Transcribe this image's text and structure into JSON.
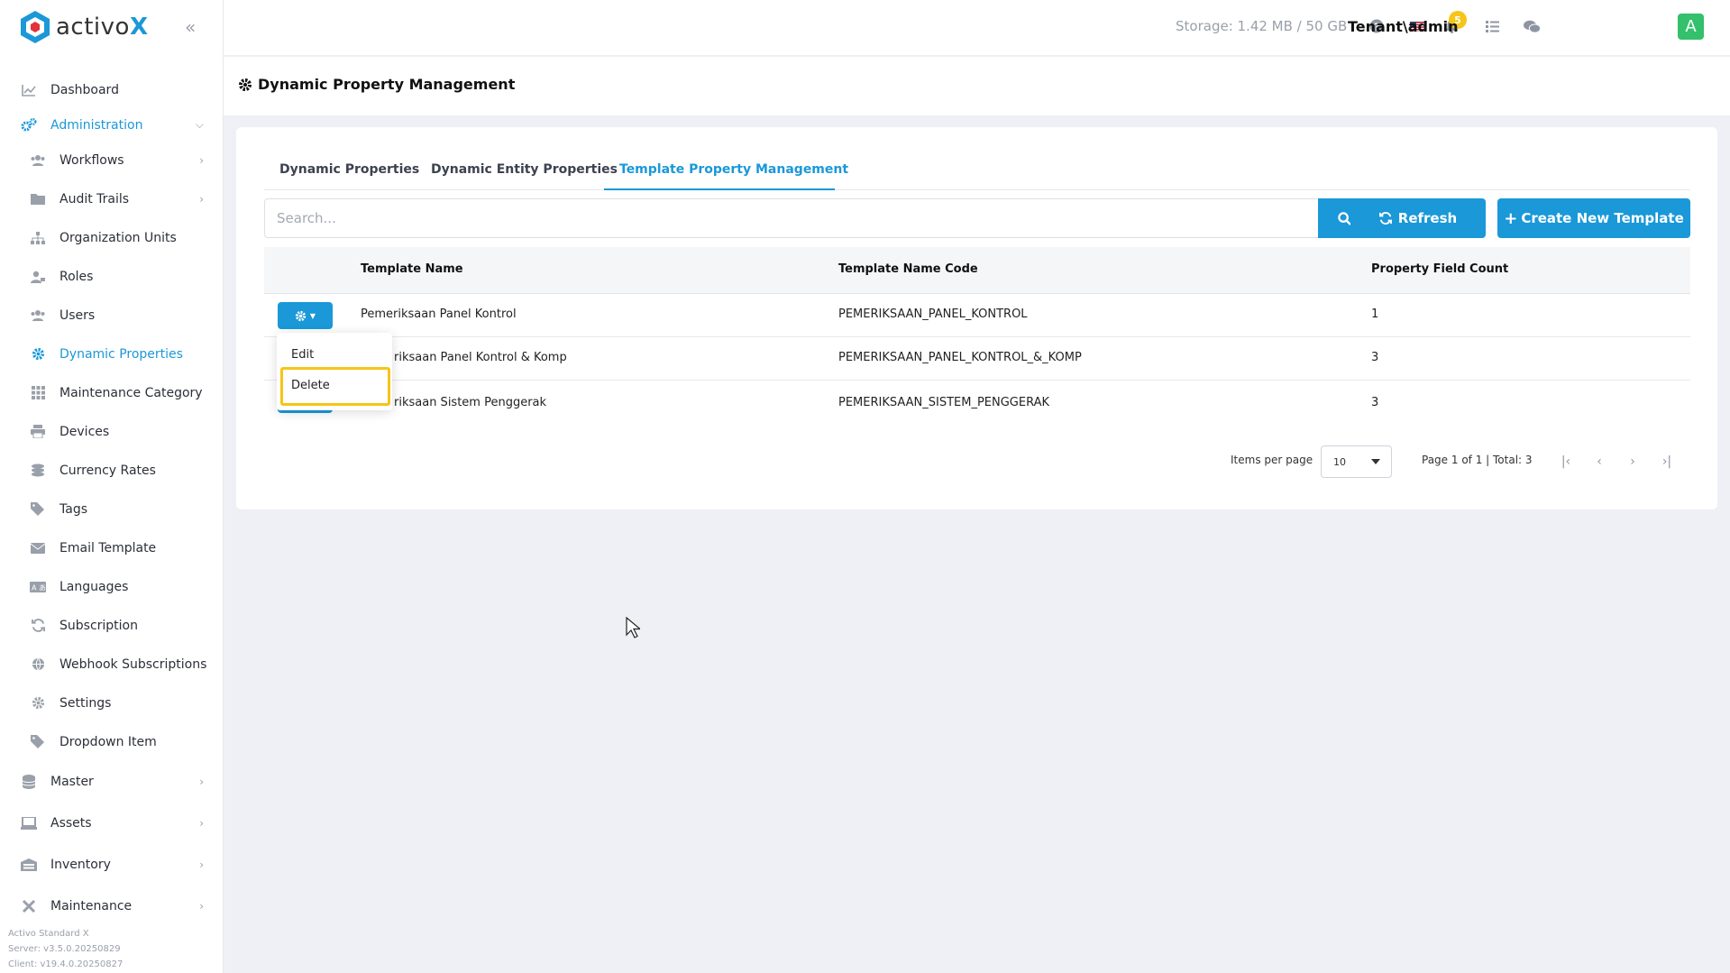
{
  "brand": {
    "name_pre": "activo",
    "name_post": "X"
  },
  "sidebar": {
    "items": [
      {
        "label": "Dashboard",
        "icon": "chart-line-icon"
      },
      {
        "label": "Administration",
        "icon": "cogs-icon",
        "active": true,
        "expanded": true
      },
      {
        "label": "Workflows",
        "icon": "users-icon",
        "has_children": true
      },
      {
        "label": "Audit Trails",
        "icon": "folder-icon",
        "has_children": true
      },
      {
        "label": "Organization Units",
        "icon": "sitemap-icon"
      },
      {
        "label": "Roles",
        "icon": "user-tag-icon"
      },
      {
        "label": "Users",
        "icon": "users-icon"
      },
      {
        "label": "Dynamic Properties",
        "icon": "gear-icon",
        "active": true
      },
      {
        "label": "Maintenance Category",
        "icon": "grid-icon"
      },
      {
        "label": "Devices",
        "icon": "printer-icon"
      },
      {
        "label": "Currency Rates",
        "icon": "coins-icon"
      },
      {
        "label": "Tags",
        "icon": "tags-icon"
      },
      {
        "label": "Email Template",
        "icon": "envelope-icon"
      },
      {
        "label": "Languages",
        "icon": "language-icon"
      },
      {
        "label": "Subscription",
        "icon": "refresh-icon"
      },
      {
        "label": "Webhook Subscriptions",
        "icon": "globe-icon"
      },
      {
        "label": "Settings",
        "icon": "gear-icon"
      },
      {
        "label": "Dropdown Item",
        "icon": "tags-icon"
      },
      {
        "label": "Master",
        "icon": "database-icon",
        "has_children": true
      },
      {
        "label": "Assets",
        "icon": "laptop-icon",
        "has_children": true
      },
      {
        "label": "Inventory",
        "icon": "warehouse-icon",
        "has_children": true
      },
      {
        "label": "Maintenance",
        "icon": "tools-icon",
        "has_children": true
      }
    ],
    "version": {
      "product": "Activo Standard X",
      "server": "Server: v3.5.0.20250829",
      "client": "Client: v19.4.0.20250827"
    }
  },
  "topbar": {
    "storage": "Storage: 1.42 MB / 50 GB",
    "notification_count": "5",
    "user": "Tenant\\admin",
    "avatar_letter": "A"
  },
  "page": {
    "title": "Dynamic Property Management"
  },
  "tabs": [
    {
      "label": "Dynamic Properties"
    },
    {
      "label": "Dynamic Entity Properties"
    },
    {
      "label": "Template Property Management",
      "active": true
    }
  ],
  "search": {
    "placeholder": "Search...",
    "value": ""
  },
  "buttons": {
    "refresh": "Refresh",
    "create": "Create New Template"
  },
  "table": {
    "columns": [
      "Template Name",
      "Template Name Code",
      "Property Field Count"
    ],
    "rows": [
      {
        "name": "Pemeriksaan Panel Kontrol",
        "code": "PEMERIKSAAN_PANEL_KONTROL",
        "count": "1"
      },
      {
        "name": "riksaan Panel Kontrol & Komp",
        "code": "PEMERIKSAAN_PANEL_KONTROL_&_KOMP",
        "count": "3"
      },
      {
        "name": "riksaan Sistem Penggerak",
        "code": "PEMERIKSAAN_SISTEM_PENGGERAK",
        "count": "3"
      }
    ]
  },
  "dropdown_menu": {
    "edit": "Edit",
    "delete": "Delete"
  },
  "pagination": {
    "items_per_page_label": "Items per page",
    "items_per_page": "10",
    "page_info": "Page 1 of 1 | Total: 3"
  },
  "colors": {
    "accent": "#1a98d8",
    "highlight": "#f5c518",
    "avatar": "#33c16b"
  }
}
